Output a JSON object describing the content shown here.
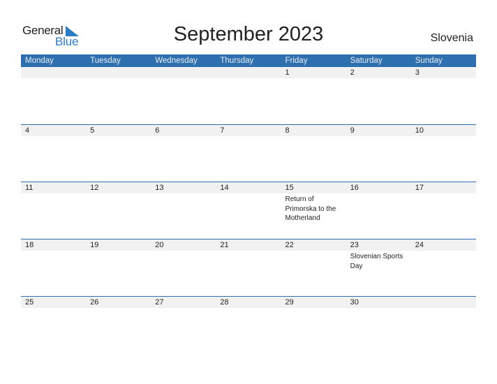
{
  "logo": {
    "line1": "General",
    "line2": "Blue"
  },
  "title": "September 2023",
  "country": "Slovenia",
  "colors": {
    "header_bg": "#2e6fb0",
    "day_strip_bg": "#f1f1f1",
    "logo_blue": "#2a7bc6"
  },
  "weekdays": [
    "Monday",
    "Tuesday",
    "Wednesday",
    "Thursday",
    "Friday",
    "Saturday",
    "Sunday"
  ],
  "weeks": [
    {
      "days": [
        "",
        "",
        "",
        "",
        "1",
        "2",
        "3"
      ],
      "events": [
        "",
        "",
        "",
        "",
        "",
        "",
        ""
      ]
    },
    {
      "days": [
        "4",
        "5",
        "6",
        "7",
        "8",
        "9",
        "10"
      ],
      "events": [
        "",
        "",
        "",
        "",
        "",
        "",
        ""
      ]
    },
    {
      "days": [
        "11",
        "12",
        "13",
        "14",
        "15",
        "16",
        "17"
      ],
      "events": [
        "",
        "",
        "",
        "",
        "Return of Primorska to the Motherland",
        "",
        ""
      ]
    },
    {
      "days": [
        "18",
        "19",
        "20",
        "21",
        "22",
        "23",
        "24"
      ],
      "events": [
        "",
        "",
        "",
        "",
        "",
        "Slovenian Sports Day",
        ""
      ]
    },
    {
      "days": [
        "25",
        "26",
        "27",
        "28",
        "29",
        "30",
        ""
      ],
      "events": [
        "",
        "",
        "",
        "",
        "",
        "",
        ""
      ]
    }
  ]
}
